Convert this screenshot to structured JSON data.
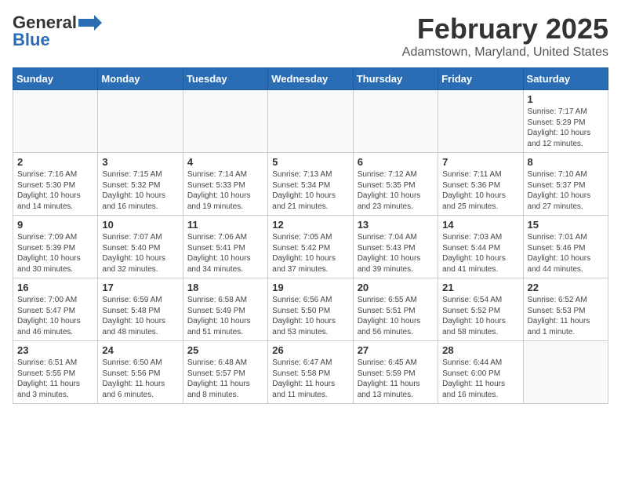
{
  "logo": {
    "general": "General",
    "blue": "Blue"
  },
  "title": "February 2025",
  "subtitle": "Adamstown, Maryland, United States",
  "days_of_week": [
    "Sunday",
    "Monday",
    "Tuesday",
    "Wednesday",
    "Thursday",
    "Friday",
    "Saturday"
  ],
  "weeks": [
    [
      {
        "day": "",
        "info": ""
      },
      {
        "day": "",
        "info": ""
      },
      {
        "day": "",
        "info": ""
      },
      {
        "day": "",
        "info": ""
      },
      {
        "day": "",
        "info": ""
      },
      {
        "day": "",
        "info": ""
      },
      {
        "day": "1",
        "info": "Sunrise: 7:17 AM\nSunset: 5:29 PM\nDaylight: 10 hours\nand 12 minutes."
      }
    ],
    [
      {
        "day": "2",
        "info": "Sunrise: 7:16 AM\nSunset: 5:30 PM\nDaylight: 10 hours\nand 14 minutes."
      },
      {
        "day": "3",
        "info": "Sunrise: 7:15 AM\nSunset: 5:32 PM\nDaylight: 10 hours\nand 16 minutes."
      },
      {
        "day": "4",
        "info": "Sunrise: 7:14 AM\nSunset: 5:33 PM\nDaylight: 10 hours\nand 19 minutes."
      },
      {
        "day": "5",
        "info": "Sunrise: 7:13 AM\nSunset: 5:34 PM\nDaylight: 10 hours\nand 21 minutes."
      },
      {
        "day": "6",
        "info": "Sunrise: 7:12 AM\nSunset: 5:35 PM\nDaylight: 10 hours\nand 23 minutes."
      },
      {
        "day": "7",
        "info": "Sunrise: 7:11 AM\nSunset: 5:36 PM\nDaylight: 10 hours\nand 25 minutes."
      },
      {
        "day": "8",
        "info": "Sunrise: 7:10 AM\nSunset: 5:37 PM\nDaylight: 10 hours\nand 27 minutes."
      }
    ],
    [
      {
        "day": "9",
        "info": "Sunrise: 7:09 AM\nSunset: 5:39 PM\nDaylight: 10 hours\nand 30 minutes."
      },
      {
        "day": "10",
        "info": "Sunrise: 7:07 AM\nSunset: 5:40 PM\nDaylight: 10 hours\nand 32 minutes."
      },
      {
        "day": "11",
        "info": "Sunrise: 7:06 AM\nSunset: 5:41 PM\nDaylight: 10 hours\nand 34 minutes."
      },
      {
        "day": "12",
        "info": "Sunrise: 7:05 AM\nSunset: 5:42 PM\nDaylight: 10 hours\nand 37 minutes."
      },
      {
        "day": "13",
        "info": "Sunrise: 7:04 AM\nSunset: 5:43 PM\nDaylight: 10 hours\nand 39 minutes."
      },
      {
        "day": "14",
        "info": "Sunrise: 7:03 AM\nSunset: 5:44 PM\nDaylight: 10 hours\nand 41 minutes."
      },
      {
        "day": "15",
        "info": "Sunrise: 7:01 AM\nSunset: 5:46 PM\nDaylight: 10 hours\nand 44 minutes."
      }
    ],
    [
      {
        "day": "16",
        "info": "Sunrise: 7:00 AM\nSunset: 5:47 PM\nDaylight: 10 hours\nand 46 minutes."
      },
      {
        "day": "17",
        "info": "Sunrise: 6:59 AM\nSunset: 5:48 PM\nDaylight: 10 hours\nand 48 minutes."
      },
      {
        "day": "18",
        "info": "Sunrise: 6:58 AM\nSunset: 5:49 PM\nDaylight: 10 hours\nand 51 minutes."
      },
      {
        "day": "19",
        "info": "Sunrise: 6:56 AM\nSunset: 5:50 PM\nDaylight: 10 hours\nand 53 minutes."
      },
      {
        "day": "20",
        "info": "Sunrise: 6:55 AM\nSunset: 5:51 PM\nDaylight: 10 hours\nand 56 minutes."
      },
      {
        "day": "21",
        "info": "Sunrise: 6:54 AM\nSunset: 5:52 PM\nDaylight: 10 hours\nand 58 minutes."
      },
      {
        "day": "22",
        "info": "Sunrise: 6:52 AM\nSunset: 5:53 PM\nDaylight: 11 hours\nand 1 minute."
      }
    ],
    [
      {
        "day": "23",
        "info": "Sunrise: 6:51 AM\nSunset: 5:55 PM\nDaylight: 11 hours\nand 3 minutes."
      },
      {
        "day": "24",
        "info": "Sunrise: 6:50 AM\nSunset: 5:56 PM\nDaylight: 11 hours\nand 6 minutes."
      },
      {
        "day": "25",
        "info": "Sunrise: 6:48 AM\nSunset: 5:57 PM\nDaylight: 11 hours\nand 8 minutes."
      },
      {
        "day": "26",
        "info": "Sunrise: 6:47 AM\nSunset: 5:58 PM\nDaylight: 11 hours\nand 11 minutes."
      },
      {
        "day": "27",
        "info": "Sunrise: 6:45 AM\nSunset: 5:59 PM\nDaylight: 11 hours\nand 13 minutes."
      },
      {
        "day": "28",
        "info": "Sunrise: 6:44 AM\nSunset: 6:00 PM\nDaylight: 11 hours\nand 16 minutes."
      },
      {
        "day": "",
        "info": ""
      }
    ]
  ]
}
